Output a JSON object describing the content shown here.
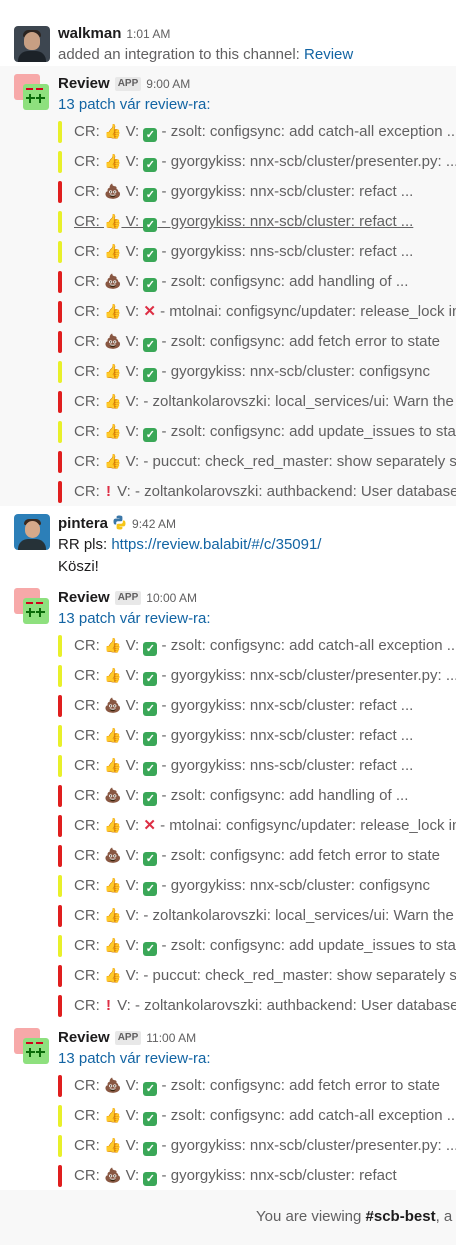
{
  "messages": [
    {
      "type": "user",
      "avatar": "walkman-avatar",
      "name": "walkman",
      "time": "1:01 AM",
      "text_prefix": "added an integration to this channel: ",
      "link": "Review"
    },
    {
      "type": "review",
      "name": "Review",
      "badge": "APP",
      "time": "9:00 AM",
      "summary": "13 patch vár review-ra:",
      "patches": [
        {
          "color": "yellow",
          "cr": "👍",
          "v": "check",
          "text": " - zsolt: configsync: add catch-all exception ..."
        },
        {
          "color": "yellow",
          "cr": "👍",
          "v": "check",
          "text": " - gyorgykiss: nnx-scb/cluster/presenter.py: ..."
        },
        {
          "color": "red",
          "cr": "💩",
          "v": "check",
          "text": " - gyorgykiss: nnx-scb/cluster: refact ..."
        },
        {
          "color": "yellow",
          "cr": "👍",
          "v": "check",
          "text": " - gyorgykiss: nnx-scb/cluster: refact ...",
          "underline": true
        },
        {
          "color": "yellow",
          "cr": "👍",
          "v": "check",
          "text": " - gyorgykiss: nns-scb/cluster: refact ..."
        },
        {
          "color": "red",
          "cr": "💩",
          "v": "check",
          "text": " - zsolt: configsync: add handling of ..."
        },
        {
          "color": "red",
          "cr": "👍",
          "v": "cross",
          "text": " - mtolnai: configsync/updater: release_lock in"
        },
        {
          "color": "red",
          "cr": "💩",
          "v": "check",
          "text": " - zsolt: configsync: add fetch error to state"
        },
        {
          "color": "yellow",
          "cr": "👍",
          "v": "check",
          "text": " - gyorgykiss: nnx-scb/cluster: configsync"
        },
        {
          "color": "red",
          "cr": "👍",
          "v": "none",
          "text": " - zoltankolarovszki: local_services/ui: Warn the u"
        },
        {
          "color": "yellow",
          "cr": "👍",
          "v": "check",
          "text": " - zsolt: configsync: add update_issues to state"
        },
        {
          "color": "red",
          "cr": "👍",
          "v": "none",
          "text": " - puccut: check_red_master: show separately sec"
        },
        {
          "color": "red",
          "cr": "bang",
          "v": "none",
          "text": " - zoltankolarovszki: authbackend: User database c"
        }
      ]
    },
    {
      "type": "user",
      "avatar": "pintera-avatar",
      "name": "pintera",
      "time": "9:42 AM",
      "python_icon": "python-logo-icon",
      "line1_prefix": "RR pls: ",
      "link": "https://review.balabit/#/c/35091/",
      "line2": "Köszi!"
    },
    {
      "type": "review",
      "name": "Review",
      "badge": "APP",
      "time": "10:00 AM",
      "summary": "13 patch vár review-ra:",
      "patches": [
        {
          "color": "yellow",
          "cr": "👍",
          "v": "check",
          "text": " - zsolt: configsync: add catch-all exception ..."
        },
        {
          "color": "yellow",
          "cr": "👍",
          "v": "check",
          "text": " - gyorgykiss: nnx-scb/cluster/presenter.py: ..."
        },
        {
          "color": "red",
          "cr": "💩",
          "v": "check",
          "text": " - gyorgykiss: nnx-scb/cluster: refact ..."
        },
        {
          "color": "yellow",
          "cr": "👍",
          "v": "check",
          "text": " - gyorgykiss: nnx-scb/cluster: refact ..."
        },
        {
          "color": "yellow",
          "cr": "👍",
          "v": "check",
          "text": " - gyorgykiss: nns-scb/cluster: refact ..."
        },
        {
          "color": "red",
          "cr": "💩",
          "v": "check",
          "text": " - zsolt: configsync: add handling of ..."
        },
        {
          "color": "red",
          "cr": "👍",
          "v": "cross",
          "text": " - mtolnai: configsync/updater: release_lock in"
        },
        {
          "color": "red",
          "cr": "💩",
          "v": "check",
          "text": " - zsolt: configsync: add fetch error to state"
        },
        {
          "color": "yellow",
          "cr": "👍",
          "v": "check",
          "text": " - gyorgykiss: nnx-scb/cluster: configsync"
        },
        {
          "color": "red",
          "cr": "👍",
          "v": "none",
          "text": " - zoltankolarovszki: local_services/ui: Warn the u"
        },
        {
          "color": "yellow",
          "cr": "👍",
          "v": "check",
          "text": " - zsolt: configsync: add update_issues to state"
        },
        {
          "color": "red",
          "cr": "👍",
          "v": "none",
          "text": " - puccut: check_red_master: show separately sec"
        },
        {
          "color": "red",
          "cr": "bang",
          "v": "none",
          "text": " - zoltankolarovszki: authbackend: User database c"
        }
      ]
    },
    {
      "type": "review",
      "name": "Review",
      "badge": "APP",
      "time": "11:00 AM",
      "summary": "13 patch vár review-ra:",
      "patches": [
        {
          "color": "red",
          "cr": "💩",
          "v": "check",
          "text": " - zsolt: configsync: add fetch error to state"
        },
        {
          "color": "yellow",
          "cr": "👍",
          "v": "check",
          "text": " - zsolt: configsync: add catch-all exception ..."
        },
        {
          "color": "yellow",
          "cr": "👍",
          "v": "check",
          "text": " - gyorgykiss: nnx-scb/cluster/presenter.py: ..."
        },
        {
          "color": "red",
          "cr": "💩",
          "v": "check",
          "text": " - gyorgykiss: nnx-scb/cluster: refact"
        }
      ]
    }
  ],
  "footer": {
    "prefix": "You are viewing ",
    "channel": "#scb-best",
    "suffix": ", a"
  },
  "colors": {
    "red_bar": "#e01e1e",
    "yellow_bar": "#e8f02a",
    "link": "#1264a3",
    "check_green": "#3aa757"
  }
}
